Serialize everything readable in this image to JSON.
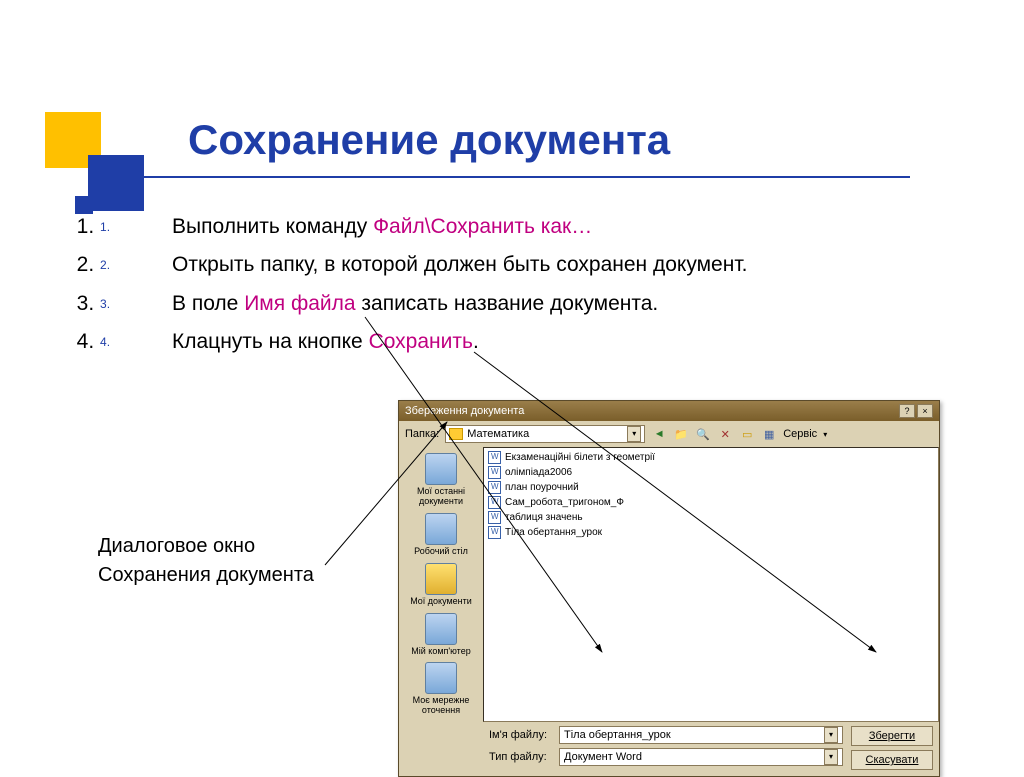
{
  "title": "Сохранение документа",
  "steps": [
    {
      "pre": "Выполнить команду ",
      "accent": "Файл\\Сохранить как…",
      "post": ""
    },
    {
      "pre": "Открыть папку, в которой должен быть сохранен документ.",
      "accent": "",
      "post": ""
    },
    {
      "pre": "В поле ",
      "accent": "Имя файла",
      "post": " записать название документа."
    },
    {
      "pre": "Клацнуть на кнопке ",
      "accent": "Сохранить",
      "post": "."
    }
  ],
  "caption_line1": "Диалоговое окно",
  "caption_line2": "Сохранения документа",
  "dialog": {
    "title": "Збереження документа",
    "folder_label": "Папка:",
    "folder": "Математика",
    "toolbar_service": "Сервіс",
    "places": [
      "Мої останні документи",
      "Робочий стіл",
      "Мої документи",
      "Мій комп'ютер",
      "Моє мережне оточення"
    ],
    "files": [
      "Екзаменаційні білети з геометрії",
      "олімпіада2006",
      "план поурочний",
      "Сам_робота_тригоном_Ф",
      "таблиця значень",
      "Тіла обертання_урок"
    ],
    "filename_label": "Ім'я файлу:",
    "filename": "Тіла обертання_урок",
    "filetype_label": "Тип файлу:",
    "filetype": "Документ Word",
    "save_btn": "Зберегти",
    "cancel_btn": "Скасувати"
  }
}
